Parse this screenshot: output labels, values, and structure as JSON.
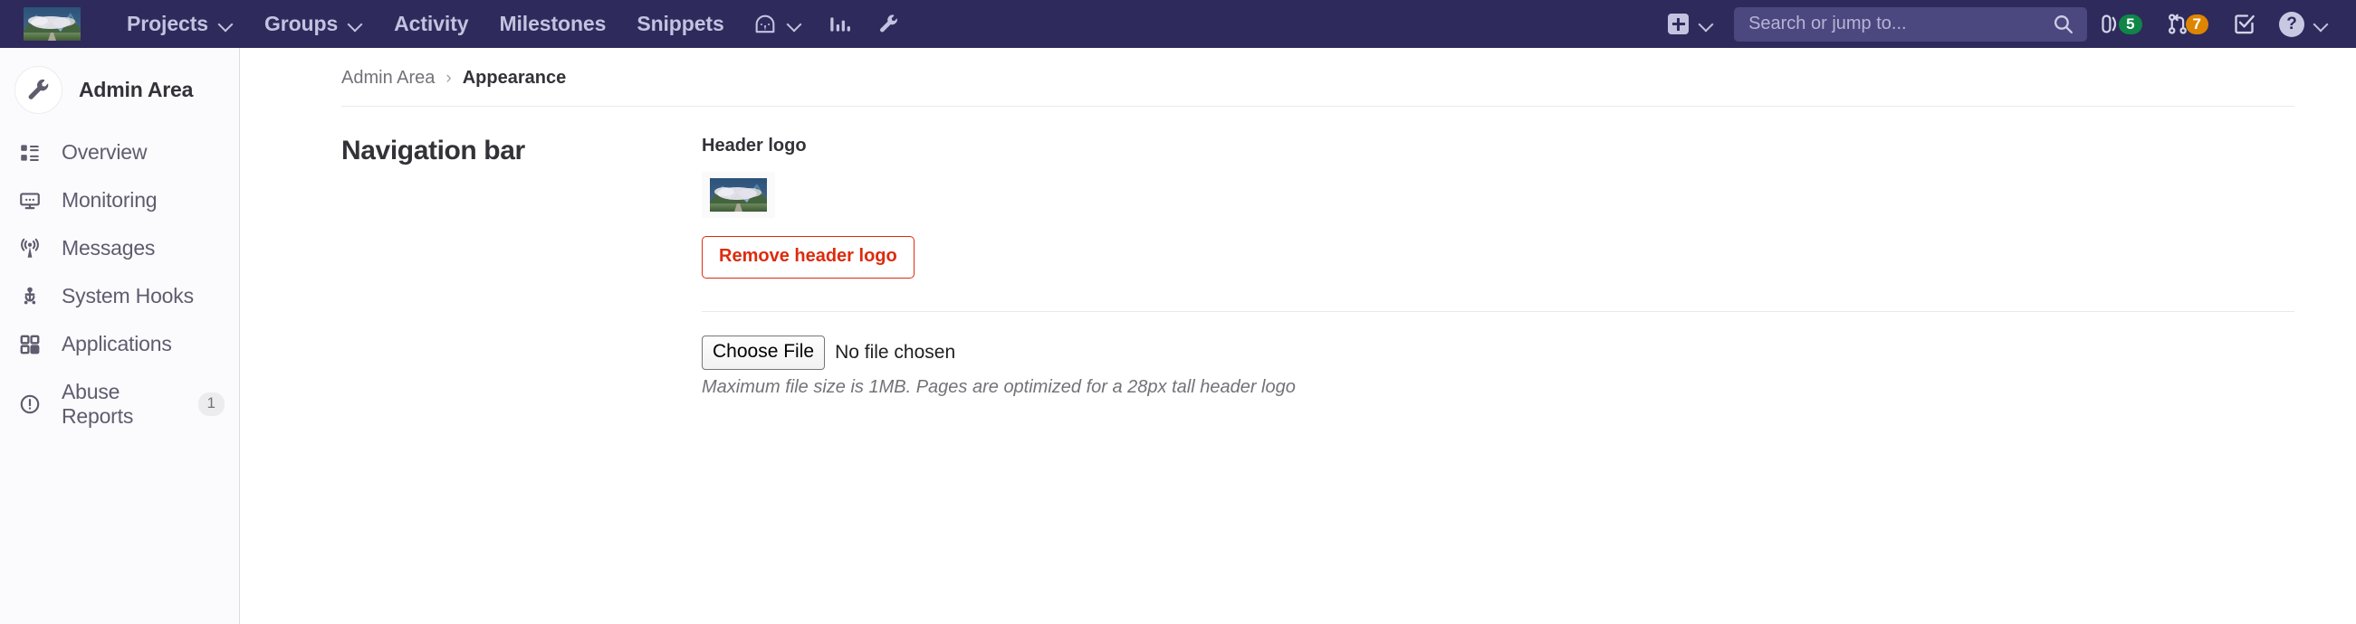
{
  "topnav": {
    "logo_icon": "header-logo-image",
    "links": [
      {
        "label": "Projects",
        "has_chevron": true
      },
      {
        "label": "Groups",
        "has_chevron": true
      },
      {
        "label": "Activity",
        "has_chevron": false
      },
      {
        "label": "Milestones",
        "has_chevron": false
      },
      {
        "label": "Snippets",
        "has_chevron": false
      }
    ],
    "icon_buttons": [
      {
        "icon": "dashboard-gauge-icon",
        "has_chevron": true
      },
      {
        "icon": "analytics-bar-chart-icon",
        "has_chevron": false
      },
      {
        "icon": "admin-wrench-icon",
        "has_chevron": false
      }
    ],
    "create_new": {
      "icon": "plus-square-icon",
      "has_chevron": true
    },
    "search": {
      "value": "",
      "placeholder": "Search or jump to...",
      "icon": "search-icon"
    },
    "counters": [
      {
        "icon": "issues-icon",
        "count": "5",
        "color": "#108548"
      },
      {
        "icon": "merge-requests-icon",
        "count": "7",
        "color": "#dd8500"
      },
      {
        "icon": "todos-checkbox-icon",
        "count": "",
        "color": ""
      }
    ],
    "help": {
      "glyph": "?",
      "icon": "help-icon",
      "has_chevron": true
    },
    "background_color": "#2e2a5b"
  },
  "sidebar": {
    "context": {
      "title": "Admin Area",
      "avatar_icon": "wrench-icon"
    },
    "items": [
      {
        "label": "Overview",
        "icon": "dashboard-list-icon",
        "badge": ""
      },
      {
        "label": "Monitoring",
        "icon": "monitor-icon",
        "badge": ""
      },
      {
        "label": "Messages",
        "icon": "broadcast-icon",
        "badge": ""
      },
      {
        "label": "System Hooks",
        "icon": "hook-icon",
        "badge": ""
      },
      {
        "label": "Applications",
        "icon": "applications-grid-icon",
        "badge": ""
      },
      {
        "label": "Abuse Reports",
        "icon": "abuse-report-icon",
        "badge": "1"
      }
    ]
  },
  "main": {
    "breadcrumb": {
      "parent": "Admin Area",
      "separator": "›",
      "current": "Appearance"
    },
    "section": {
      "title": "Navigation bar"
    },
    "header_logo": {
      "label": "Header logo",
      "preview_icon": "header-logo-thumbnail",
      "remove_button": "Remove header logo",
      "file_input": {
        "button_label": "Choose File",
        "status": "No file chosen"
      },
      "hint": "Maximum file size is 1MB. Pages are optimized for a 28px tall header logo"
    }
  },
  "colors": {
    "nav_background": "#2e2a5b",
    "danger": "#dd2b0e",
    "badge_green": "#108548",
    "badge_orange": "#dd8500",
    "sidebar_background": "#fbfafd"
  }
}
